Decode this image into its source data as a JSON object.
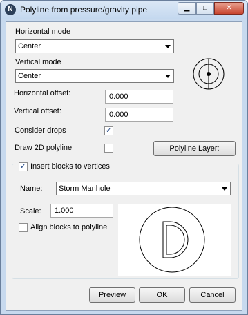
{
  "window": {
    "title": "Polyline from pressure/gravity pipe",
    "icon_letter": "N",
    "minimize_glyph": "▁",
    "maximize_glyph": "□",
    "close_glyph": "✕"
  },
  "horizontal_mode": {
    "label": "Horizontal mode",
    "value": "Center"
  },
  "vertical_mode": {
    "label": "Vertical mode",
    "value": "Center"
  },
  "horizontal_offset": {
    "label": "Horizontal offset:",
    "value": "0.000"
  },
  "vertical_offset": {
    "label": "Vertical offset:",
    "value": "0.000"
  },
  "consider_drops": {
    "label": "Consider drops",
    "checked": true,
    "mark": "✓"
  },
  "draw_2d": {
    "label": "Draw 2D polyline",
    "checked": false,
    "mark": ""
  },
  "polyline_layer_button": "Polyline Layer:",
  "insert_blocks": {
    "label": "Insert blocks to vertices",
    "checked": true,
    "mark": "✓"
  },
  "block_name": {
    "label": "Name:",
    "value": "Storm Manhole"
  },
  "scale": {
    "label": "Scale:",
    "value": "1.000"
  },
  "align_blocks": {
    "label": "Align blocks to polyline",
    "checked": false,
    "mark": ""
  },
  "buttons": {
    "preview": "Preview",
    "ok": "OK",
    "cancel": "Cancel"
  }
}
